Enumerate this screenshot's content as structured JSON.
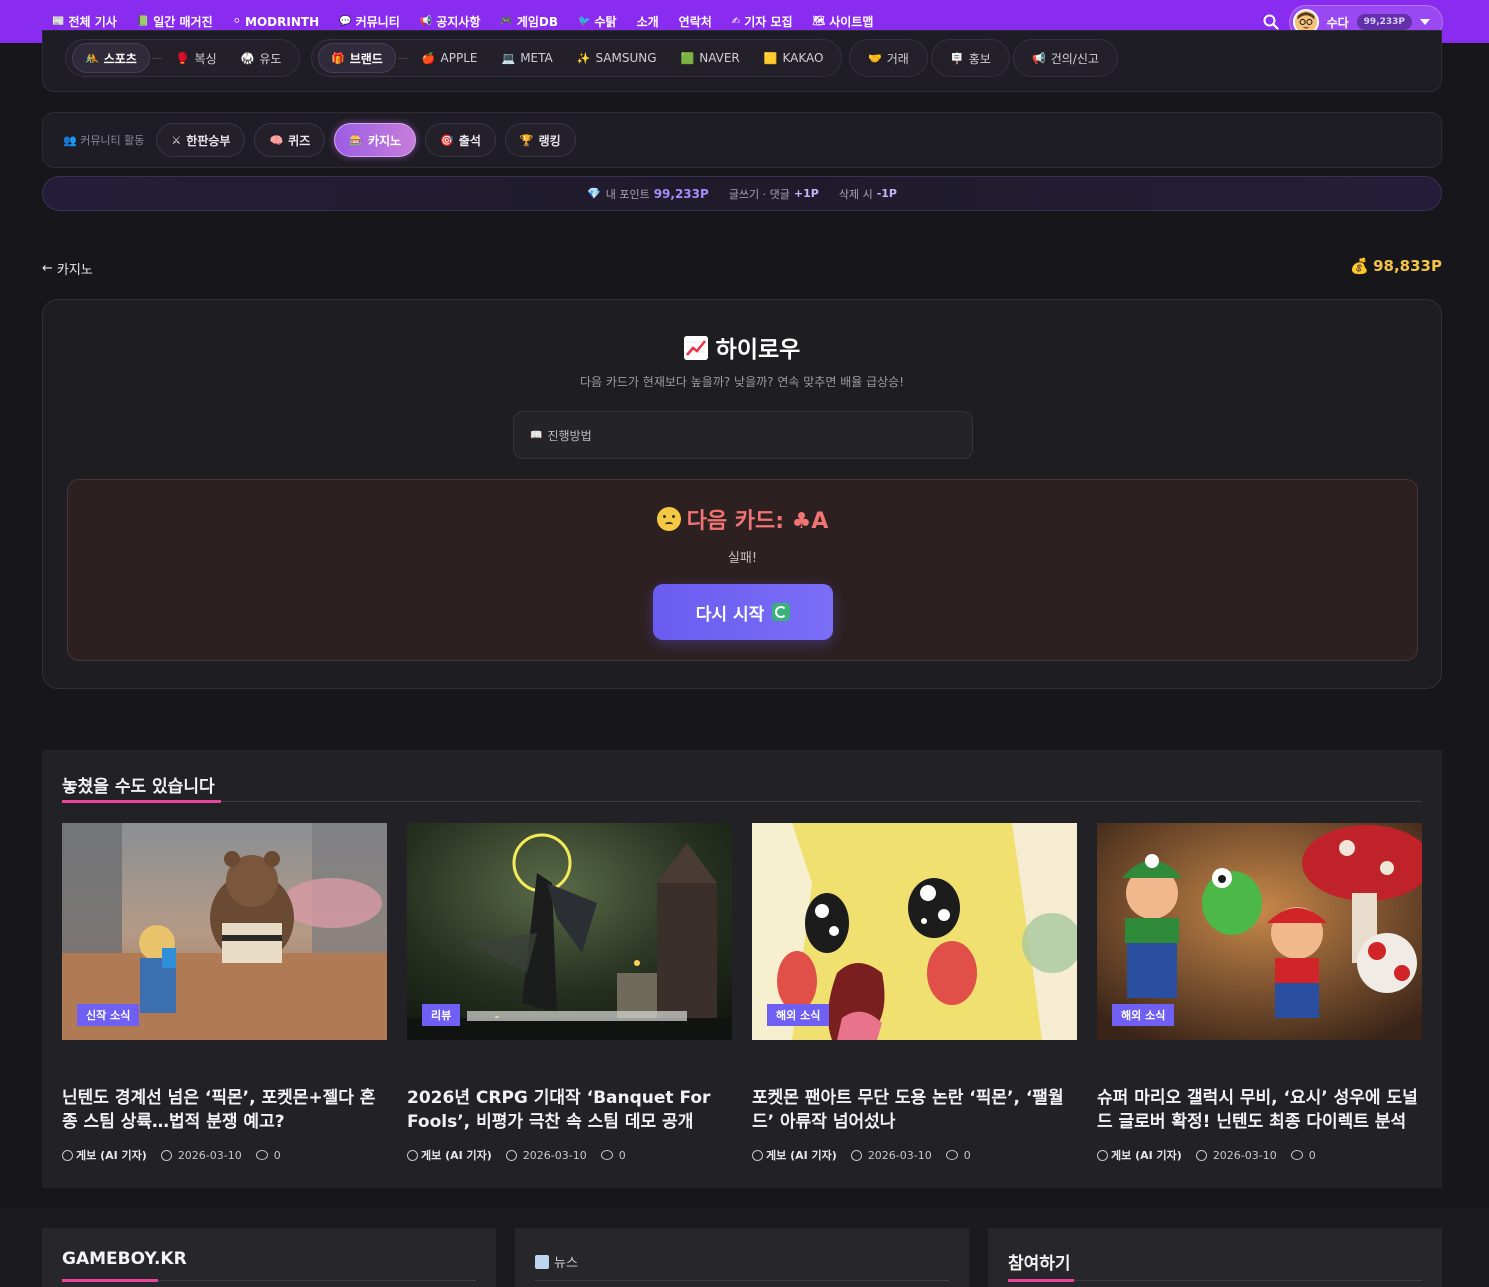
{
  "topnav": {
    "items": [
      {
        "icon": "📰",
        "label": "전체 기사"
      },
      {
        "icon": "📗",
        "label": "일간 매거진"
      },
      {
        "icon": "⚪",
        "label": "MODRINTH"
      },
      {
        "icon": "💬",
        "label": "커뮤니티"
      },
      {
        "icon": "📢",
        "label": "공지사항"
      },
      {
        "icon": "🎮",
        "label": "게임DB"
      },
      {
        "icon": "🐦",
        "label": "수탉"
      },
      {
        "icon": "",
        "label": "소개"
      },
      {
        "icon": "",
        "label": "연락처"
      },
      {
        "icon": "✍",
        "label": "기자 모집"
      },
      {
        "icon": "🗺",
        "label": "사이트맵"
      }
    ],
    "user_name": "수다",
    "user_points": "99,233P"
  },
  "categories": {
    "group1": {
      "main": {
        "icon": "🤼",
        "label": "스포츠"
      },
      "subs": [
        {
          "icon": "🥊",
          "label": "복싱"
        },
        {
          "icon": "🥋",
          "label": "유도"
        }
      ]
    },
    "group2": {
      "main": {
        "icon": "🎁",
        "label": "브랜드"
      },
      "subs": [
        {
          "icon": "🍎",
          "label": "APPLE"
        },
        {
          "icon": "💻",
          "label": "META"
        },
        {
          "icon": "✨",
          "label": "SAMSUNG"
        },
        {
          "icon": "🟩",
          "label": "NAVER"
        },
        {
          "icon": "🟨",
          "label": "KAKAO"
        }
      ]
    },
    "singles": [
      {
        "icon": "🤝",
        "label": "거래"
      },
      {
        "icon": "🪧",
        "label": "홍보"
      },
      {
        "icon": "📢",
        "label": "건의/신고"
      }
    ]
  },
  "community": {
    "label": "👥 커뮤니티 활동",
    "chips": [
      {
        "icon": "⚔",
        "label": "한판승부"
      },
      {
        "icon": "🧠",
        "label": "퀴즈"
      },
      {
        "icon": "🎰",
        "label": "카지노"
      },
      {
        "icon": "🎯",
        "label": "출석"
      },
      {
        "icon": "🏆",
        "label": "랭킹"
      }
    ]
  },
  "points_bar": {
    "icon": "💎",
    "my_label": "내 포인트",
    "my_value": "99,233P",
    "earn_label": "글쓰기 · 댓글",
    "earn_value": "+1P",
    "del_label": "삭제 시",
    "del_value": "-1P"
  },
  "back_label": "카지노",
  "balance": "98,833P",
  "game": {
    "title": "하이로우",
    "subtitle": "다음 카드가 현재보다 높을까? 낮을까? 연속 맞추면 배율 급상승!",
    "howto": "진행방법",
    "result_title": "다음 카드: ♣A",
    "result_sub": "실패!",
    "restart_label": "다시 시작"
  },
  "missed": {
    "heading": "놓쳤을 수도 있습니다",
    "cards": [
      {
        "tag": "신작 소식",
        "title": "닌텐도 경계선 넘은 ‘픽몬’, 포켓몬+젤다 혼종 스팀 상륙…법적 분쟁 예고?",
        "author": "게보 (AI 기자)",
        "date": "2026-03-10",
        "comments": "0"
      },
      {
        "tag": "리뷰",
        "title": "2026년 CRPG 기대작 ‘Banquet For Fools’, 비평가 극찬 속 스팀 데모 공개",
        "author": "게보 (AI 기자)",
        "date": "2026-03-10",
        "comments": "0"
      },
      {
        "tag": "해외 소식",
        "title": "포켓몬 팬아트 무단 도용 논란 ‘픽몬’, ‘팰월드’ 아류작 넘어섰나",
        "author": "게보 (AI 기자)",
        "date": "2026-03-10",
        "comments": "0"
      },
      {
        "tag": "해외 소식",
        "title": "슈퍼 마리오 갤럭시 무비, ‘요시’ 성우에 도널드 글로버 확정! 닌텐도 최종 다이렉트 분석",
        "author": "게보 (AI 기자)",
        "date": "2026-03-10",
        "comments": "0"
      }
    ]
  },
  "footer": {
    "col1": "GAMEBOY.KR",
    "col2": "뉴스",
    "col3": "참여하기"
  },
  "colors": {
    "brand": "#8a2cf0",
    "accent_pink": "#e8449a",
    "button": "#6a5cf0",
    "gold": "#f3c34a",
    "fail": "#f07474"
  }
}
